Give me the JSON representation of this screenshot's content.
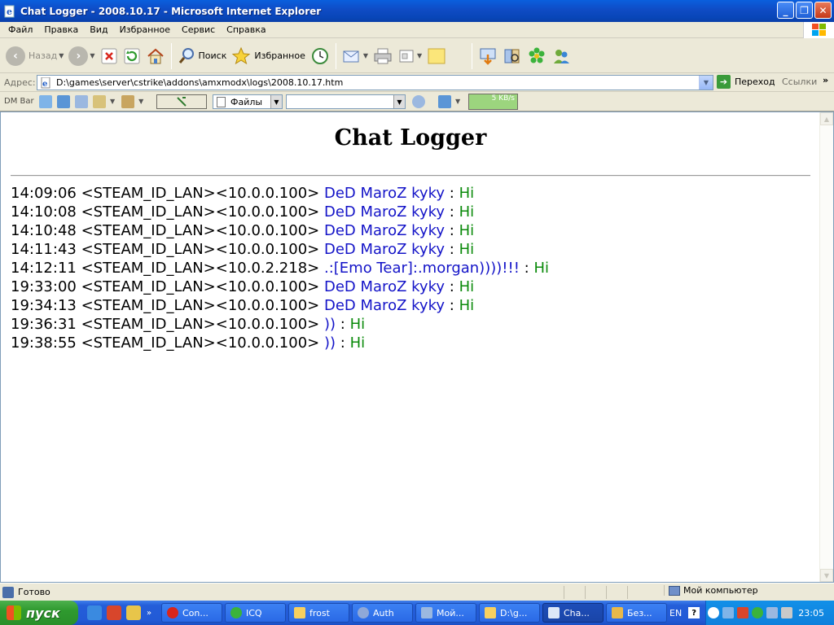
{
  "window": {
    "title": "Chat Logger - 2008.10.17 - Microsoft Internet Explorer",
    "buttons": {
      "minimize": "_",
      "maximize": "❐",
      "close": "✕"
    }
  },
  "menu": [
    "Файл",
    "Правка",
    "Вид",
    "Избранное",
    "Сервис",
    "Справка"
  ],
  "toolbar": {
    "back": "Назад",
    "search": "Поиск",
    "favorites": "Избранное"
  },
  "address": {
    "label": "Адрес:",
    "url": "D:\\games\\server\\cstrike\\addons\\amxmodx\\logs\\2008.10.17.htm",
    "go": "Переход",
    "links": "Ссылки"
  },
  "dmbar": {
    "label": "DM Bar",
    "files": "Файлы",
    "speed": "5 KB/s"
  },
  "page": {
    "title": "Chat Logger",
    "log": [
      {
        "meta": "14:09:06 <STEAM_ID_LAN><10.0.0.100>",
        "name": "DeD MaroZ kyky",
        "msg": "Hi"
      },
      {
        "meta": "14:10:08 <STEAM_ID_LAN><10.0.0.100>",
        "name": "DeD MaroZ kyky",
        "msg": "Hi"
      },
      {
        "meta": "14:10:48 <STEAM_ID_LAN><10.0.0.100>",
        "name": "DeD MaroZ kyky",
        "msg": "Hi"
      },
      {
        "meta": "14:11:43 <STEAM_ID_LAN><10.0.0.100>",
        "name": "DeD MaroZ kyky",
        "msg": "Hi"
      },
      {
        "meta": "14:12:11 <STEAM_ID_LAN><10.0.2.218>",
        "name": ".:[Emo Tear]:.morgan))))!!!",
        "msg": "Hi"
      },
      {
        "meta": "19:33:00 <STEAM_ID_LAN><10.0.0.100>",
        "name": "DeD MaroZ kyky",
        "msg": "Hi"
      },
      {
        "meta": "19:34:13 <STEAM_ID_LAN><10.0.0.100>",
        "name": "DeD MaroZ kyky",
        "msg": "Hi"
      },
      {
        "meta": "19:36:31 <STEAM_ID_LAN><10.0.0.100>",
        "name": "))",
        "msg": "Hi"
      },
      {
        "meta": "19:38:55 <STEAM_ID_LAN><10.0.0.100>",
        "name": "))",
        "msg": "Hi"
      }
    ],
    "separator": ":"
  },
  "status": {
    "text": "Готово",
    "zone": "Мой компьютер"
  },
  "taskbar": {
    "start": "пуск",
    "tasks": [
      "Con...",
      "ICQ",
      "frost",
      "Auth",
      "Мой...",
      "D:\\g...",
      "Cha...",
      "Без..."
    ],
    "lang": "EN",
    "clock": "23:05"
  },
  "colors": {
    "name": "#1414C8",
    "message": "#0A8A0A",
    "titlebar": "#0A5FDD"
  }
}
